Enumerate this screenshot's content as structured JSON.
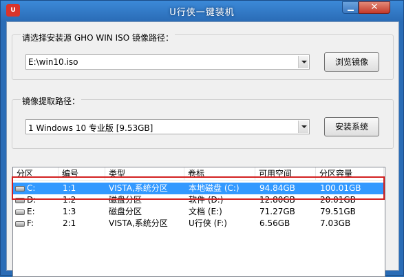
{
  "window": {
    "title": "U行侠一键装机",
    "icon_label": "U行侠",
    "close_symbol": "✕"
  },
  "source_group": {
    "label": "请选择安装源 GHO WIN ISO 镜像路径：",
    "path_value": "E:\\win10.iso",
    "browse_button": "浏览镜像"
  },
  "extract_group": {
    "label": "镜像提取路径：",
    "image_value": "1 Windows 10 专业版 [9.53GB]",
    "install_button": "安装系统"
  },
  "partition_table": {
    "columns": [
      "分区",
      "编号",
      "类型",
      "卷标",
      "可用空间",
      "分区容量"
    ],
    "rows": [
      {
        "drive": "C:",
        "number": "1:1",
        "type": "VISTA,系统分区",
        "label": "本地磁盘 (C:)",
        "free": "94.84GB",
        "capacity": "100.01GB",
        "selected": true
      },
      {
        "drive": "D:",
        "number": "1:2",
        "type": "磁盘分区",
        "label": "软件 (D:)",
        "free": "12.80GB",
        "capacity": "20.01GB",
        "selected": false
      },
      {
        "drive": "E:",
        "number": "1:3",
        "type": "磁盘分区",
        "label": "文档 (E:)",
        "free": "71.27GB",
        "capacity": "79.51GB",
        "selected": false
      },
      {
        "drive": "F:",
        "number": "2:1",
        "type": "VISTA,系统分区",
        "label": "U行侠 (F:)",
        "free": "6.56GB",
        "capacity": "7.03GB",
        "selected": false
      }
    ]
  },
  "colors": {
    "title_bar": "#2a6cb6",
    "selection": "#3399ff",
    "highlight_annotation": "#d32020"
  }
}
